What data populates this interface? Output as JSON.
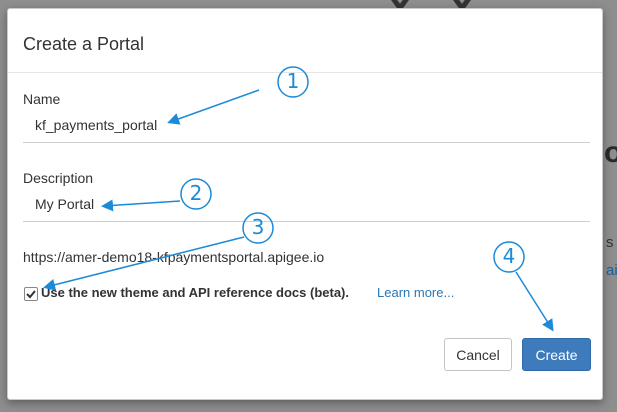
{
  "dialog": {
    "title": "Create a Portal",
    "name_label": "Name",
    "name_value": "kf_payments_portal",
    "description_label": "Description",
    "description_value": "My Portal",
    "portal_url": "https://amer-demo18-kfpaymentsportal.apigee.io",
    "theme_checkbox_checked": true,
    "theme_checkbox_label": "Use the new theme and API reference docs (beta).",
    "learn_more_link": "Learn more...",
    "cancel_label": "Cancel",
    "create_label": "Create"
  },
  "background": {
    "glyph_o": "o",
    "glyph_s": "s",
    "glyph_l": "ai"
  },
  "annotations": {
    "markers": [
      "1",
      "2",
      "3",
      "4"
    ],
    "color": "#1b8ad8"
  },
  "colors": {
    "primary_button": "#3d7bbc",
    "link": "#2a77b5",
    "annotation": "#1b8ad8"
  }
}
